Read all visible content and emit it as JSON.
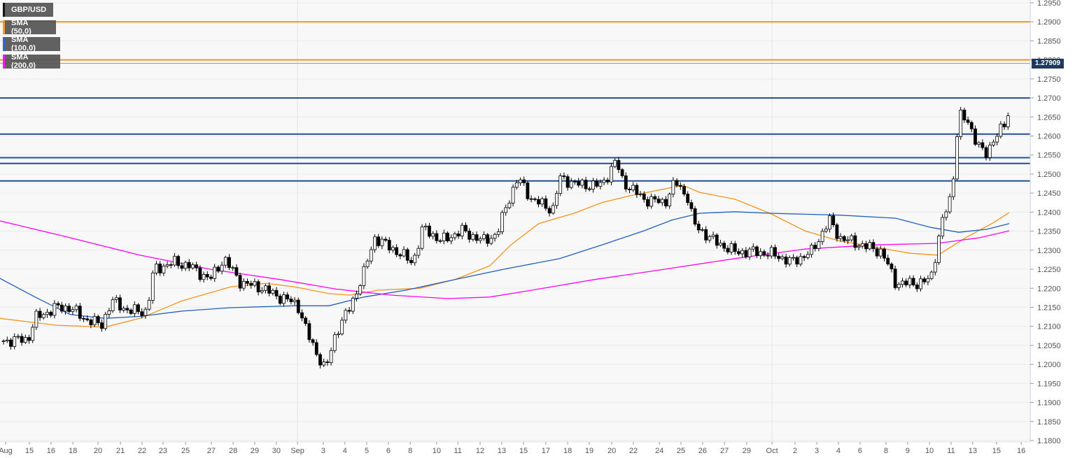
{
  "legend": [
    {
      "label": "GBP/USD",
      "color": "#000000"
    },
    {
      "label": "SMA (50,0)",
      "color": "#f7931a"
    },
    {
      "label": "SMA (100,0)",
      "color": "#1f5fbf"
    },
    {
      "label": "SMA (200,0)",
      "color": "#ff00ff"
    }
  ],
  "chart_data": {
    "type": "candlestick",
    "title": "GBP/USD",
    "current_price": "1.27909",
    "ylim": [
      1.18,
      1.295
    ],
    "y_ticks": [
      "1.1800",
      "1.1850",
      "1.1900",
      "1.1950",
      "1.2000",
      "1.2050",
      "1.2100",
      "1.2150",
      "1.2200",
      "1.2250",
      "1.2300",
      "1.2350",
      "1.2400",
      "1.2450",
      "1.2500",
      "1.2550",
      "1.2600",
      "1.2650",
      "1.2700",
      "1.2750",
      "1.2800",
      "1.2850",
      "1.2900",
      "1.2950"
    ],
    "x_ticks": [
      {
        "label": "Aug",
        "t": 0
      },
      {
        "label": "15",
        "t": 1.09
      },
      {
        "label": "16",
        "t": 2.08
      },
      {
        "label": "18",
        "t": 3.08
      },
      {
        "label": "20",
        "t": 4.23
      },
      {
        "label": "21",
        "t": 5.26
      },
      {
        "label": "22",
        "t": 6.25
      },
      {
        "label": "23",
        "t": 7.21
      },
      {
        "label": "25",
        "t": 8.24
      },
      {
        "label": "27",
        "t": 9.42
      },
      {
        "label": "28",
        "t": 10.42
      },
      {
        "label": "29",
        "t": 11.41
      },
      {
        "label": "30",
        "t": 12.4
      },
      {
        "label": "Sep",
        "t": 13.37
      },
      {
        "label": "3",
        "t": 14.55
      },
      {
        "label": "4",
        "t": 15.54
      },
      {
        "label": "5",
        "t": 16.54
      },
      {
        "label": "6",
        "t": 17.53
      },
      {
        "label": "8",
        "t": 18.53
      },
      {
        "label": "10",
        "t": 19.74
      },
      {
        "label": "11",
        "t": 20.71
      },
      {
        "label": "12",
        "t": 21.73
      },
      {
        "label": "13",
        "t": 22.72
      },
      {
        "label": "15",
        "t": 23.72
      },
      {
        "label": "17",
        "t": 24.74
      },
      {
        "label": "18",
        "t": 25.74
      },
      {
        "label": "19",
        "t": 26.73
      },
      {
        "label": "20",
        "t": 27.76
      },
      {
        "label": "22",
        "t": 28.75
      },
      {
        "label": "24",
        "t": 29.94
      },
      {
        "label": "25",
        "t": 30.93
      },
      {
        "label": "26",
        "t": 31.92
      },
      {
        "label": "27",
        "t": 32.92
      },
      {
        "label": "29",
        "t": 33.94
      },
      {
        "label": "Oct",
        "t": 35.1
      },
      {
        "label": "2",
        "t": 36.15
      },
      {
        "label": "3",
        "t": 37.15
      },
      {
        "label": "4",
        "t": 38.14
      },
      {
        "label": "6",
        "t": 39.13
      },
      {
        "label": "8",
        "t": 40.32
      },
      {
        "label": "9",
        "t": 41.31
      },
      {
        "label": "10",
        "t": 42.31
      },
      {
        "label": "11",
        "t": 43.3
      },
      {
        "label": "13",
        "t": 44.29
      },
      {
        "label": "15",
        "t": 45.38
      },
      {
        "label": "16",
        "t": 46.51
      }
    ],
    "horizontal_levels": [
      {
        "price": 1.29,
        "color": "#f7931a"
      },
      {
        "price": 1.28,
        "color": "#f7931a"
      },
      {
        "price": 1.27,
        "color": "#1f4e9c"
      },
      {
        "price": 1.2605,
        "color": "#1f4e9c"
      },
      {
        "price": 1.2543,
        "color": "#1f4e9c"
      },
      {
        "price": 1.2528,
        "color": "#1f4e9c"
      },
      {
        "price": 1.2482,
        "color": "#1f4e9c"
      }
    ],
    "price_path": [
      [
        -0.26,
        1.2061
      ],
      [
        1.03,
        1.2066
      ],
      [
        1.35,
        1.2121
      ],
      [
        2.31,
        1.2149
      ],
      [
        2.95,
        1.2149
      ],
      [
        3.59,
        1.2121
      ],
      [
        4.39,
        1.2103
      ],
      [
        4.87,
        1.2167
      ],
      [
        5.67,
        1.214
      ],
      [
        6.47,
        1.214
      ],
      [
        6.79,
        1.225
      ],
      [
        7.76,
        1.2268
      ],
      [
        8.4,
        1.2259
      ],
      [
        9.36,
        1.2223
      ],
      [
        10.0,
        1.2278
      ],
      [
        10.8,
        1.2213
      ],
      [
        11.6,
        1.2204
      ],
      [
        12.56,
        1.2177
      ],
      [
        13.37,
        1.2158
      ],
      [
        13.85,
        1.2076
      ],
      [
        14.65,
        1.1984
      ],
      [
        15.13,
        1.2085
      ],
      [
        15.77,
        1.2149
      ],
      [
        16.41,
        1.2241
      ],
      [
        16.89,
        1.2333
      ],
      [
        17.69,
        1.2305
      ],
      [
        18.65,
        1.2268
      ],
      [
        19.13,
        1.236
      ],
      [
        19.94,
        1.2324
      ],
      [
        20.9,
        1.2351
      ],
      [
        21.86,
        1.2324
      ],
      [
        22.5,
        1.2342
      ],
      [
        22.98,
        1.2425
      ],
      [
        23.46,
        1.2489
      ],
      [
        24.1,
        1.2434
      ],
      [
        25.06,
        1.2406
      ],
      [
        25.38,
        1.2489
      ],
      [
        26.35,
        1.2471
      ],
      [
        27.31,
        1.2471
      ],
      [
        27.95,
        1.2535
      ],
      [
        28.27,
        1.248
      ],
      [
        29.23,
        1.2434
      ],
      [
        30.19,
        1.2425
      ],
      [
        30.67,
        1.248
      ],
      [
        31.31,
        1.2434
      ],
      [
        31.47,
        1.237
      ],
      [
        32.44,
        1.2324
      ],
      [
        33.4,
        1.2296
      ],
      [
        34.36,
        1.2296
      ],
      [
        35.32,
        1.2287
      ],
      [
        35.96,
        1.2268
      ],
      [
        36.92,
        1.2296
      ],
      [
        37.72,
        1.2379
      ],
      [
        38.2,
        1.2333
      ],
      [
        39.17,
        1.2314
      ],
      [
        40.13,
        1.2296
      ],
      [
        40.77,
        1.2213
      ],
      [
        41.73,
        1.2213
      ],
      [
        42.37,
        1.2223
      ],
      [
        42.85,
        1.237
      ],
      [
        43.33,
        1.2443
      ],
      [
        43.65,
        1.2663
      ],
      [
        44.13,
        1.2627
      ],
      [
        44.62,
        1.2572
      ],
      [
        44.94,
        1.2544
      ],
      [
        45.26,
        1.2599
      ],
      [
        45.9,
        1.2636
      ],
      [
        45.96,
        1.27909
      ]
    ],
    "series": [
      {
        "name": "SMA (50,0)",
        "color": "#f7931a",
        "points": [
          [
            -0.26,
            1.2121
          ],
          [
            2.31,
            1.2103
          ],
          [
            4.55,
            1.2098
          ],
          [
            6.15,
            1.2121
          ],
          [
            8.08,
            1.2167
          ],
          [
            10.32,
            1.2204
          ],
          [
            11.92,
            1.2213
          ],
          [
            13.21,
            1.2204
          ],
          [
            14.81,
            1.2186
          ],
          [
            15.77,
            1.2182
          ],
          [
            17.05,
            1.2195
          ],
          [
            18.97,
            1.22
          ],
          [
            20.58,
            1.2223
          ],
          [
            22.18,
            1.2259
          ],
          [
            23.14,
            1.2314
          ],
          [
            24.42,
            1.237
          ],
          [
            26.03,
            1.2397
          ],
          [
            27.31,
            1.2425
          ],
          [
            28.59,
            1.2443
          ],
          [
            30.19,
            1.2461
          ],
          [
            30.99,
            1.2471
          ],
          [
            31.79,
            1.2452
          ],
          [
            33.4,
            1.2434
          ],
          [
            35.0,
            1.2397
          ],
          [
            36.6,
            1.2351
          ],
          [
            38.21,
            1.2324
          ],
          [
            40.13,
            1.2305
          ],
          [
            41.41,
            1.2292
          ],
          [
            42.69,
            1.2287
          ],
          [
            43.97,
            1.2333
          ],
          [
            45.26,
            1.2373
          ],
          [
            45.96,
            1.2399
          ]
        ]
      },
      {
        "name": "SMA (100,0)",
        "color": "#1f5fbf",
        "points": [
          [
            -0.26,
            1.2226
          ],
          [
            1.35,
            1.2177
          ],
          [
            2.95,
            1.2131
          ],
          [
            4.55,
            1.2121
          ],
          [
            6.15,
            1.2126
          ],
          [
            8.08,
            1.214
          ],
          [
            10.32,
            1.2149
          ],
          [
            13.21,
            1.2154
          ],
          [
            14.81,
            1.2154
          ],
          [
            16.41,
            1.2177
          ],
          [
            18.33,
            1.2195
          ],
          [
            20.58,
            1.2223
          ],
          [
            22.82,
            1.225
          ],
          [
            25.38,
            1.2278
          ],
          [
            27.31,
            1.2314
          ],
          [
            29.23,
            1.2351
          ],
          [
            30.51,
            1.2379
          ],
          [
            31.79,
            1.2397
          ],
          [
            33.4,
            1.2401
          ],
          [
            35.0,
            1.2397
          ],
          [
            38.21,
            1.2392
          ],
          [
            40.77,
            1.2384
          ],
          [
            42.37,
            1.236
          ],
          [
            43.65,
            1.2347
          ],
          [
            44.94,
            1.2355
          ],
          [
            45.96,
            1.237
          ]
        ]
      },
      {
        "name": "SMA (200,0)",
        "color": "#ff00ff",
        "points": [
          [
            -0.26,
            1.2377
          ],
          [
            2.95,
            1.2333
          ],
          [
            6.15,
            1.2287
          ],
          [
            9.36,
            1.225
          ],
          [
            12.56,
            1.2223
          ],
          [
            15.13,
            1.2198
          ],
          [
            17.69,
            1.2182
          ],
          [
            20.26,
            1.2173
          ],
          [
            22.18,
            1.2177
          ],
          [
            24.1,
            1.2195
          ],
          [
            26.99,
            1.2223
          ],
          [
            30.19,
            1.225
          ],
          [
            33.4,
            1.2278
          ],
          [
            36.6,
            1.2303
          ],
          [
            39.81,
            1.2314
          ],
          [
            42.69,
            1.2318
          ],
          [
            44.62,
            1.2333
          ],
          [
            45.96,
            1.2351
          ]
        ]
      }
    ]
  }
}
